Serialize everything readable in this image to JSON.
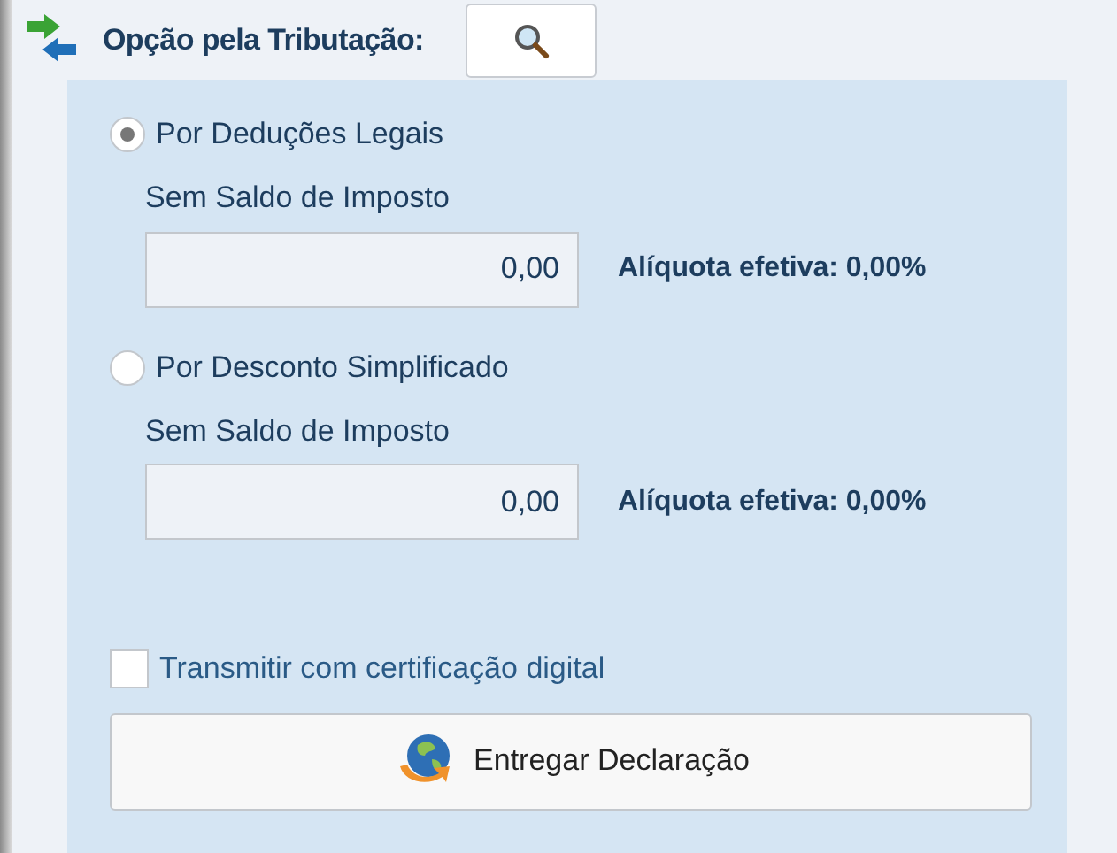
{
  "header": {
    "title": "Opção pela Tributação:"
  },
  "options": [
    {
      "label": "Por Deduções Legais",
      "selected": true,
      "caption": "Sem Saldo de Imposto",
      "value": "0,00",
      "rate": "Alíquota efetiva: 0,00%"
    },
    {
      "label": "Por Desconto Simplificado",
      "selected": false,
      "caption": "Sem Saldo de Imposto",
      "value": "0,00",
      "rate": "Alíquota efetiva: 0,00%"
    }
  ],
  "certificate": {
    "label": "Transmitir com certificação digital",
    "checked": false
  },
  "submit": {
    "label": "Entregar Declaração"
  }
}
